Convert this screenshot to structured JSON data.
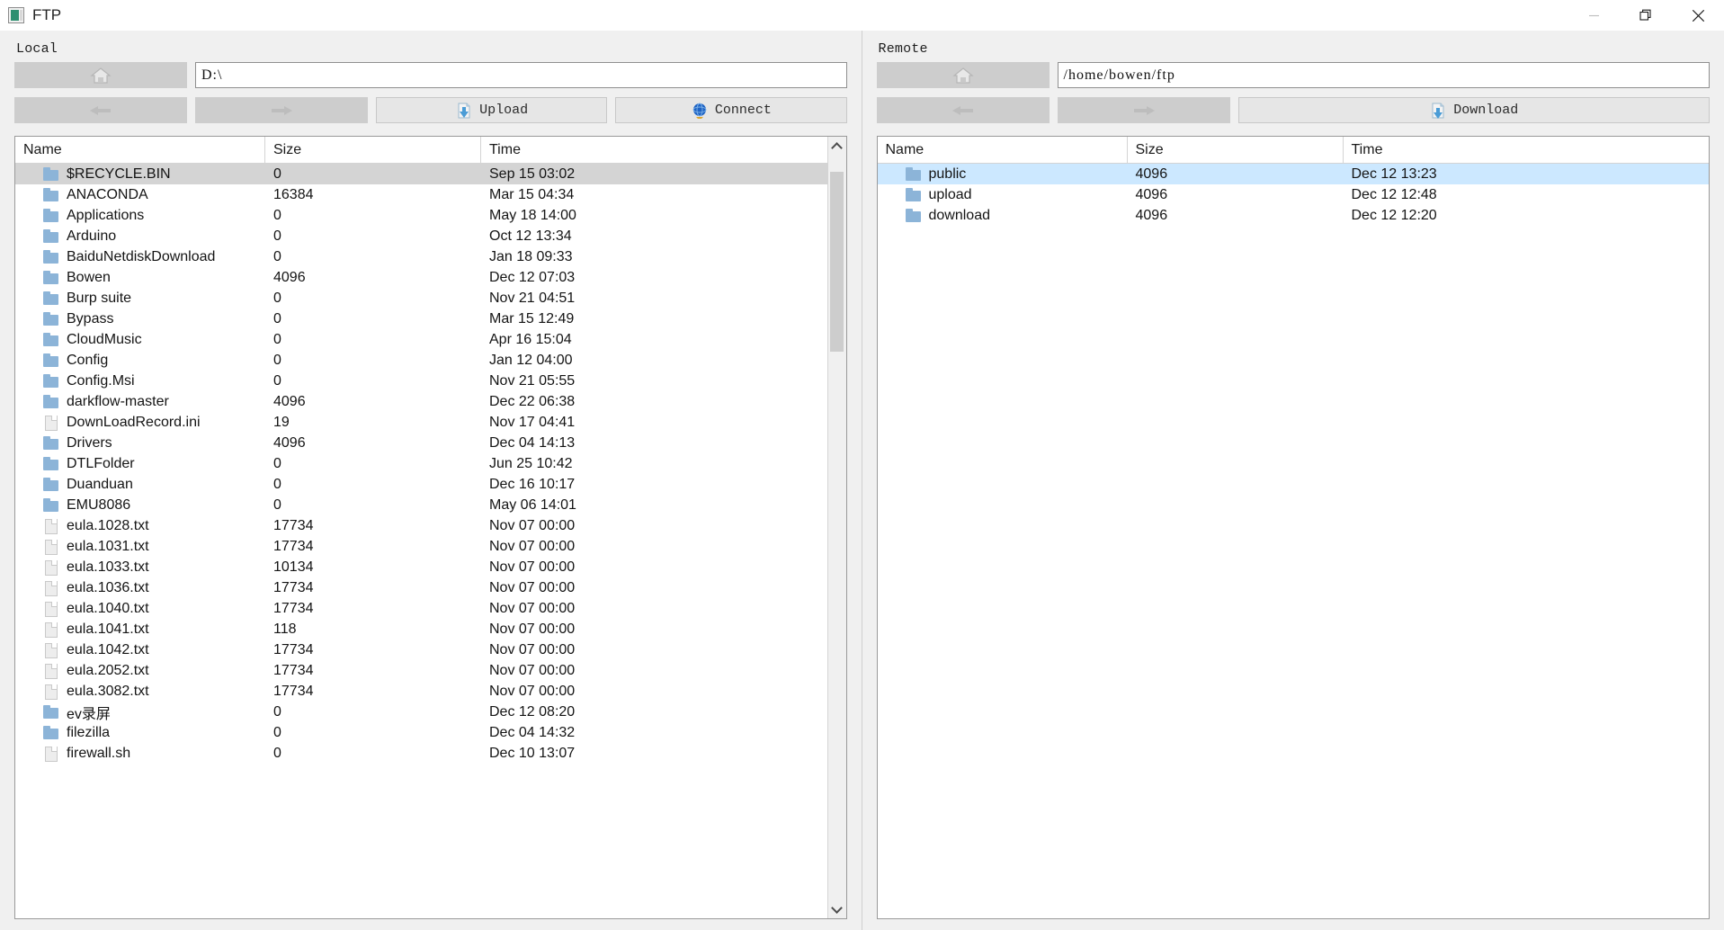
{
  "window": {
    "title": "FTP",
    "icon": "app-icon",
    "controls": {
      "minimize": "minimize-icon",
      "restore": "restore-icon",
      "close": "close-icon"
    }
  },
  "local": {
    "label": "Local",
    "home_button": "home-icon",
    "path_value": "D:\\",
    "back_button": "back-arrow-icon",
    "forward_button": "forward-arrow-icon",
    "upload_label": "Upload",
    "upload_icon": "upload-icon",
    "connect_label": "Connect",
    "connect_icon": "globe-icon",
    "columns": [
      "Name",
      "Size",
      "Time"
    ],
    "rows": [
      {
        "name": "$RECYCLE.BIN",
        "size": "0",
        "time": "Sep 15 03:02",
        "type": "folder",
        "state": "hover"
      },
      {
        "name": "ANACONDA",
        "size": "16384",
        "time": "Mar 15 04:34",
        "type": "folder",
        "state": ""
      },
      {
        "name": "Applications",
        "size": "0",
        "time": "May 18 14:00",
        "type": "folder",
        "state": ""
      },
      {
        "name": "Arduino",
        "size": "0",
        "time": "Oct 12 13:34",
        "type": "folder",
        "state": ""
      },
      {
        "name": "BaiduNetdiskDownload",
        "size": "0",
        "time": "Jan 18 09:33",
        "type": "folder",
        "state": ""
      },
      {
        "name": "Bowen",
        "size": "4096",
        "time": "Dec 12 07:03",
        "type": "folder",
        "state": ""
      },
      {
        "name": "Burp suite",
        "size": "0",
        "time": "Nov 21 04:51",
        "type": "folder",
        "state": ""
      },
      {
        "name": "Bypass",
        "size": "0",
        "time": "Mar 15 12:49",
        "type": "folder",
        "state": ""
      },
      {
        "name": "CloudMusic",
        "size": "0",
        "time": "Apr 16 15:04",
        "type": "folder",
        "state": ""
      },
      {
        "name": "Config",
        "size": "0",
        "time": "Jan 12 04:00",
        "type": "folder",
        "state": ""
      },
      {
        "name": "Config.Msi",
        "size": "0",
        "time": "Nov 21 05:55",
        "type": "folder",
        "state": ""
      },
      {
        "name": "darkflow-master",
        "size": "4096",
        "time": "Dec 22 06:38",
        "type": "folder",
        "state": ""
      },
      {
        "name": "DownLoadRecord.ini",
        "size": "19",
        "time": "Nov 17 04:41",
        "type": "file",
        "state": ""
      },
      {
        "name": "Drivers",
        "size": "4096",
        "time": "Dec 04 14:13",
        "type": "folder",
        "state": ""
      },
      {
        "name": "DTLFolder",
        "size": "0",
        "time": "Jun 25 10:42",
        "type": "folder",
        "state": ""
      },
      {
        "name": "Duanduan",
        "size": "0",
        "time": "Dec 16 10:17",
        "type": "folder",
        "state": ""
      },
      {
        "name": "EMU8086",
        "size": "0",
        "time": "May 06 14:01",
        "type": "folder",
        "state": ""
      },
      {
        "name": "eula.1028.txt",
        "size": "17734",
        "time": "Nov 07 00:00",
        "type": "file",
        "state": ""
      },
      {
        "name": "eula.1031.txt",
        "size": "17734",
        "time": "Nov 07 00:00",
        "type": "file",
        "state": ""
      },
      {
        "name": "eula.1033.txt",
        "size": "10134",
        "time": "Nov 07 00:00",
        "type": "file",
        "state": ""
      },
      {
        "name": "eula.1036.txt",
        "size": "17734",
        "time": "Nov 07 00:00",
        "type": "file",
        "state": ""
      },
      {
        "name": "eula.1040.txt",
        "size": "17734",
        "time": "Nov 07 00:00",
        "type": "file",
        "state": ""
      },
      {
        "name": "eula.1041.txt",
        "size": "118",
        "time": "Nov 07 00:00",
        "type": "file",
        "state": ""
      },
      {
        "name": "eula.1042.txt",
        "size": "17734",
        "time": "Nov 07 00:00",
        "type": "file",
        "state": ""
      },
      {
        "name": "eula.2052.txt",
        "size": "17734",
        "time": "Nov 07 00:00",
        "type": "file",
        "state": ""
      },
      {
        "name": "eula.3082.txt",
        "size": "17734",
        "time": "Nov 07 00:00",
        "type": "file",
        "state": ""
      },
      {
        "name": "ev录屏",
        "size": "0",
        "time": "Dec 12 08:20",
        "type": "folder",
        "state": ""
      },
      {
        "name": "filezilla",
        "size": "0",
        "time": "Dec 04 14:32",
        "type": "folder",
        "state": ""
      },
      {
        "name": "firewall.sh",
        "size": "0",
        "time": "Dec 10 13:07",
        "type": "file",
        "state": ""
      }
    ]
  },
  "remote": {
    "label": "Remote",
    "home_button": "home-icon",
    "path_value": "/home/bowen/ftp",
    "back_button": "back-arrow-icon",
    "forward_button": "forward-arrow-icon",
    "download_label": "Download",
    "download_icon": "download-icon",
    "columns": [
      "Name",
      "Size",
      "Time"
    ],
    "rows": [
      {
        "name": "public",
        "size": "4096",
        "time": "Dec 12 13:23",
        "type": "folder",
        "state": "sel"
      },
      {
        "name": "upload",
        "size": "4096",
        "time": "Dec 12 12:48",
        "type": "folder",
        "state": ""
      },
      {
        "name": "download",
        "size": "4096",
        "time": "Dec 12 12:20",
        "type": "folder",
        "state": ""
      }
    ]
  },
  "colors": {
    "selection": "#cce8ff",
    "hover": "#d4d4d4",
    "folder": "#8cb4d8",
    "chrome": "#f0f0f0",
    "button": "#cdcdcd"
  }
}
